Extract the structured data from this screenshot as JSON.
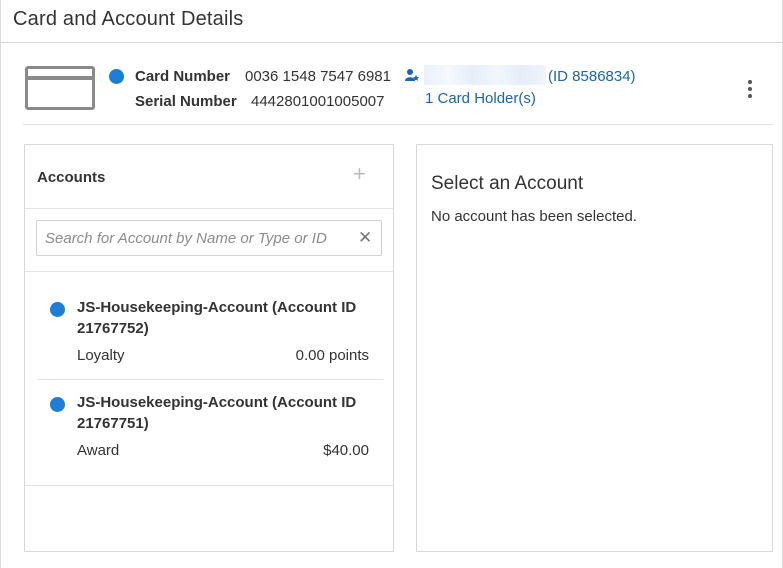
{
  "page": {
    "title": "Card and Account Details"
  },
  "card": {
    "number_label": "Card Number",
    "number_value": "0036 1548 7547 6981",
    "serial_label": "Serial Number",
    "serial_value": "4442801001005007",
    "holder_id": "(ID 8586834)",
    "holder_count_link": "1 Card Holder(s)",
    "status_color": "#1e7ed6",
    "icons": [
      "credit-card-icon",
      "card-holder-icon",
      "more-vertical-icon"
    ]
  },
  "accounts": {
    "title": "Accounts",
    "add_icon": "plus-icon",
    "search": {
      "placeholder": "Search for Account by Name or Type or ID",
      "value": "",
      "clear_icon": "close-icon"
    },
    "items": [
      {
        "name": "JS-Housekeeping-Account (Account ID 21767752)",
        "type": "Loyalty",
        "amount": "0.00 points",
        "status_color": "#1e7ed6"
      },
      {
        "name": "JS-Housekeeping-Account (Account ID 21767751)",
        "type": "Award",
        "amount": "$40.00",
        "status_color": "#1e7ed6"
      }
    ]
  },
  "detail": {
    "title": "Select an Account",
    "message": "No account has been selected."
  }
}
